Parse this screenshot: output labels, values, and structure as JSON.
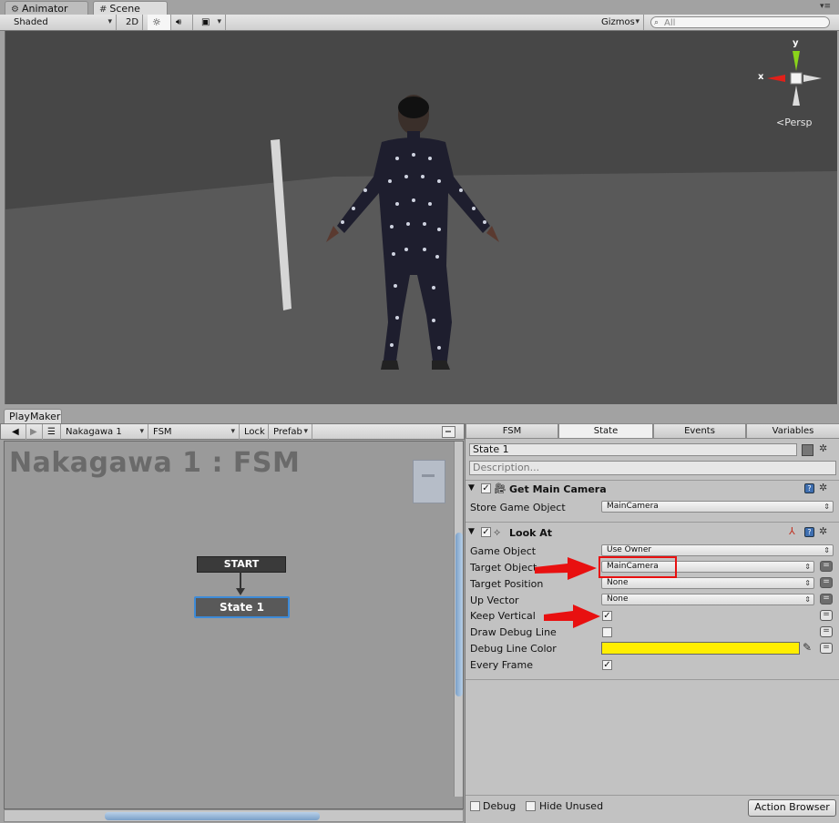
{
  "tabs": [
    {
      "icon": "animator-icon",
      "label": "Animator"
    },
    {
      "icon": "grid-icon",
      "label": "Scene"
    }
  ],
  "scene_toolbar": {
    "shading": "Shaded",
    "mode_2d": "2D",
    "gizmos": "Gizmos",
    "search_placeholder": "All"
  },
  "gizmo": {
    "y": "y",
    "x": "x",
    "projection": "Persp"
  },
  "playmaker": {
    "window_title": "PlayMaker",
    "fsm_selector": "Nakagawa 1",
    "fsm_name": "FSM",
    "lock": "Lock",
    "prefab": "Prefab",
    "graph_title": "Nakagawa 1 : FSM",
    "start_label": "START",
    "state_node": "State 1"
  },
  "inspector": {
    "tabs": [
      "FSM",
      "State",
      "Events",
      "Variables"
    ],
    "active_tab": "State",
    "state_name": "State 1",
    "description_placeholder": "Description...",
    "actions": [
      {
        "title": "Get Main Camera",
        "fields": [
          {
            "label": "Store Game Object",
            "value": "MainCamera"
          }
        ]
      },
      {
        "title": "Look At",
        "fields": [
          {
            "label": "Game Object",
            "value": "Use Owner"
          },
          {
            "label": "Target Object",
            "value": "MainCamera"
          },
          {
            "label": "Target Position",
            "value": "None"
          },
          {
            "label": "Up Vector",
            "value": "None"
          },
          {
            "label": "Keep Vertical",
            "checked": true
          },
          {
            "label": "Draw Debug Line",
            "checked": false
          },
          {
            "label": "Debug Line Color",
            "color": "#ffee00"
          },
          {
            "label": "Every Frame",
            "checked": true
          }
        ]
      }
    ],
    "footer": {
      "debug": "Debug",
      "hide_unused": "Hide Unused",
      "action_browser": "Action Browser"
    }
  },
  "colors": {
    "arrow": "#e81010",
    "highlight_box": "#e81010",
    "selection": "#3d8bd8"
  }
}
